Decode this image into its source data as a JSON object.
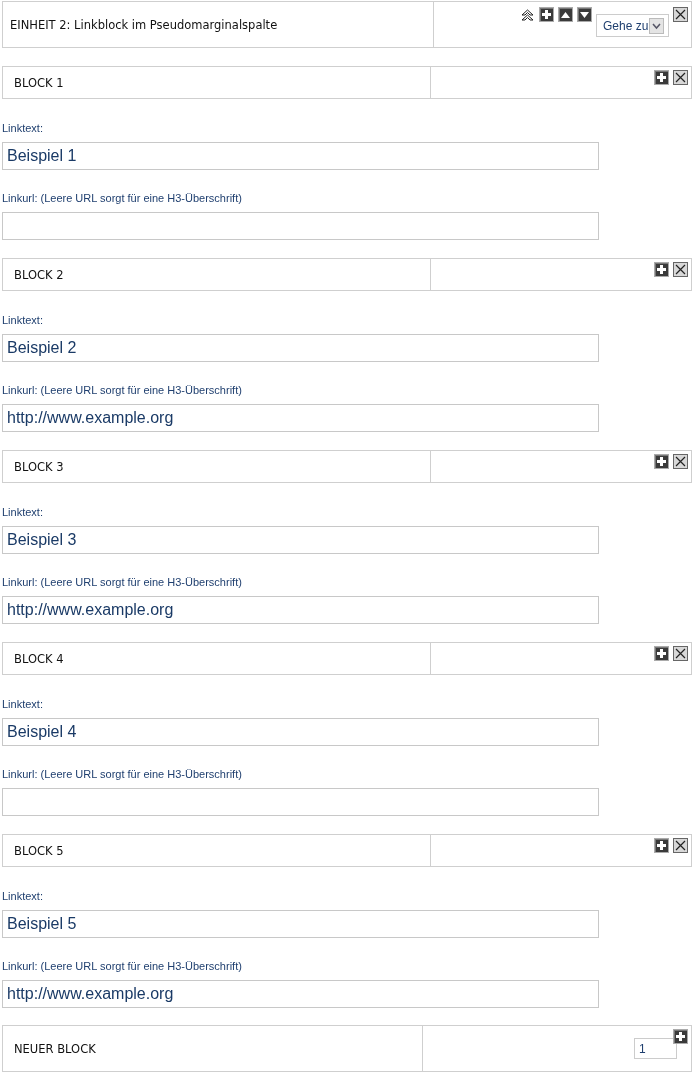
{
  "unit": {
    "title": "EINHEIT 2: Linkblock im Pseudomarginalspalte",
    "goto": "Gehe zu"
  },
  "blocks": [
    {
      "title": "BLOCK 1",
      "fields": [
        {
          "label": "Linktext:",
          "value": "Beispiel 1"
        },
        {
          "label": "Linkurl: (Leere URL sorgt für eine H3-Überschrift)"
        }
      ]
    },
    {
      "title": "BLOCK 2",
      "fields": [
        {
          "label": "Linktext:",
          "value": "Beispiel 2"
        },
        {
          "label": "Linkurl: (Leere URL sorgt für eine H3-Überschrift)",
          "value": "http://www.example.org"
        }
      ]
    },
    {
      "title": "BLOCK 3",
      "fields": [
        {
          "label": "Linktext:",
          "value": "Beispiel 3"
        },
        {
          "label": "Linkurl: (Leere URL sorgt für eine H3-Überschrift)",
          "value": "http://www.example.org"
        }
      ]
    },
    {
      "title": "BLOCK 4",
      "fields": [
        {
          "label": "Linktext:",
          "value": "Beispiel 4"
        },
        {
          "label": "Linkurl: (Leere URL sorgt für eine H3-Überschrift)"
        }
      ]
    },
    {
      "title": "BLOCK 5",
      "fields": [
        {
          "label": "Linktext:",
          "value": "Beispiel 5"
        },
        {
          "label": "Linkurl: (Leere URL sorgt für eine H3-Überschrift)",
          "value": "http://www.example.org"
        }
      ]
    }
  ],
  "new_block": {
    "title": "NEUER BLOCK",
    "count": "1"
  }
}
